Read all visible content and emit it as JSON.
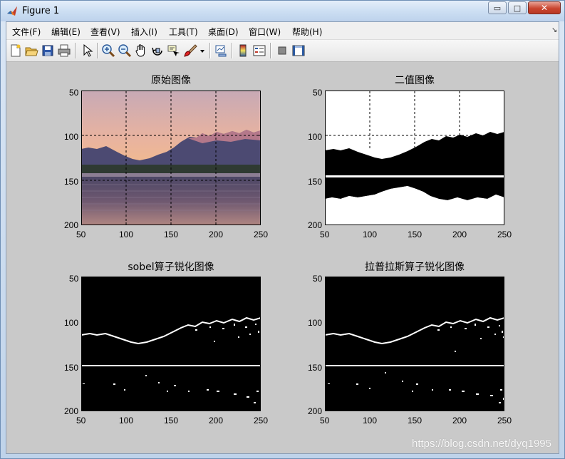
{
  "window": {
    "title": "Figure 1",
    "minimize_glyph": "▭",
    "maximize_glyph": "□",
    "close_glyph": "✕"
  },
  "menu": {
    "items": [
      {
        "label": "文件(F)"
      },
      {
        "label": "编辑(E)"
      },
      {
        "label": "查看(V)"
      },
      {
        "label": "插入(I)"
      },
      {
        "label": "工具(T)"
      },
      {
        "label": "桌面(D)"
      },
      {
        "label": "窗口(W)"
      },
      {
        "label": "帮助(H)"
      }
    ],
    "overflow_glyph": "↘"
  },
  "toolbar": {
    "icons": [
      "new-figure-icon",
      "open-file-icon",
      "save-icon",
      "print-icon",
      "edit-plot-arrow-icon",
      "zoom-in-icon",
      "zoom-out-icon",
      "pan-hand-icon",
      "rotate-3d-icon",
      "data-cursor-icon",
      "brush-icon",
      "brush-dropdown-icon",
      "link-plot-icon",
      "colorbar-icon",
      "legend-icon",
      "hide-plot-tools-icon",
      "show-plot-tools-icon"
    ]
  },
  "axes": [
    {
      "title": "原始图像",
      "xticks": [
        "50",
        "100",
        "150",
        "200",
        "250"
      ],
      "yticks": [
        "50",
        "100",
        "150",
        "200"
      ],
      "grid": true,
      "content": "photo"
    },
    {
      "title": "二值图像",
      "xticks": [
        "50",
        "100",
        "150",
        "200",
        "250"
      ],
      "yticks": [
        "50",
        "100",
        "150",
        "200"
      ],
      "grid": true,
      "content": "binary"
    },
    {
      "title": "sobel算子锐化图像",
      "xticks": [
        "50",
        "100",
        "150",
        "200",
        "250"
      ],
      "yticks": [
        "50",
        "100",
        "150",
        "200"
      ],
      "grid": false,
      "content": "edges"
    },
    {
      "title": "拉普拉斯算子锐化图像",
      "xticks": [
        "50",
        "100",
        "150",
        "200",
        "250"
      ],
      "yticks": [
        "50",
        "100",
        "150",
        "200"
      ],
      "grid": false,
      "content": "edges"
    }
  ],
  "watermark": "https://blog.csdn.net/dyq1995",
  "colors": {
    "figure_bg": "#c9c9c9",
    "menubar_bg": "#f0f0f0",
    "sky_top": "#c7a9b5",
    "sky_bottom": "#f0b888",
    "mountain": "#4a4a70",
    "water": "#5a4c62"
  }
}
